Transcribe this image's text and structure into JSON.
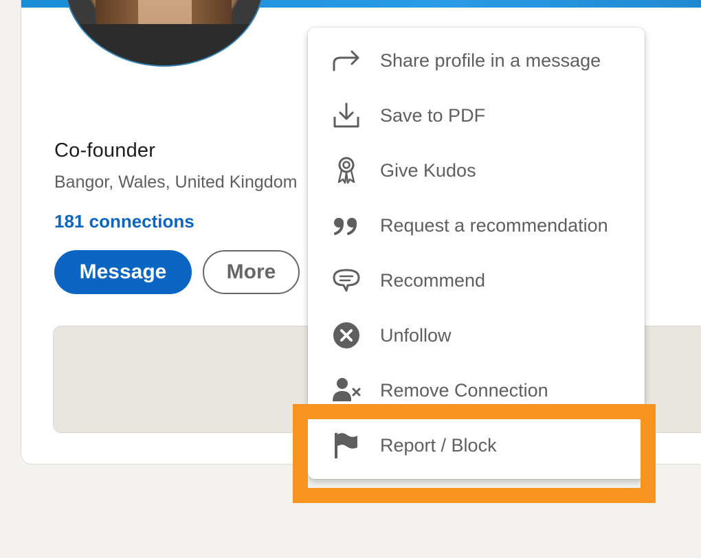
{
  "profile": {
    "headline": "Co-founder",
    "location": "Bangor, Wales, United Kingdom",
    "connections": "181 connections",
    "message_button": "Message",
    "more_button": "More"
  },
  "menu": {
    "items": [
      {
        "label": "Share profile in a message",
        "icon": "share-arrow-icon"
      },
      {
        "label": "Save to PDF",
        "icon": "download-icon"
      },
      {
        "label": "Give Kudos",
        "icon": "award-ribbon-icon"
      },
      {
        "label": "Request a recommendation",
        "icon": "quote-icon"
      },
      {
        "label": "Recommend",
        "icon": "speech-bubble-icon"
      },
      {
        "label": "Unfollow",
        "icon": "close-circle-icon"
      },
      {
        "label": "Remove Connection",
        "icon": "remove-person-icon"
      },
      {
        "label": "Report / Block",
        "icon": "flag-icon"
      }
    ]
  },
  "annotation": {
    "target": "Report / Block",
    "color": "#f7931e"
  },
  "colors": {
    "brand_blue": "#0a66c2",
    "menu_text": "#5e5e5e",
    "page_background": "#f3f2ef"
  }
}
